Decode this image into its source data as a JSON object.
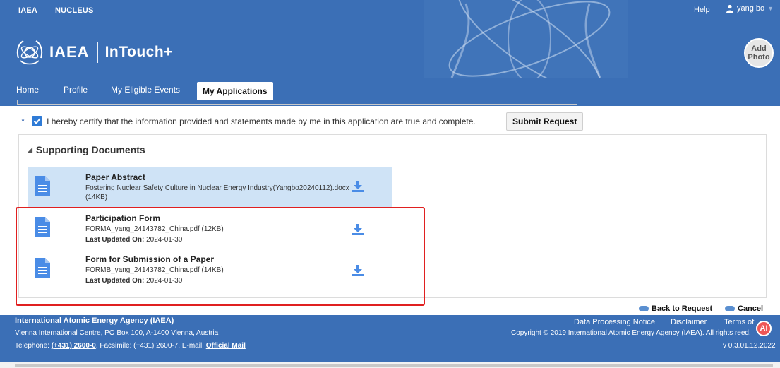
{
  "topnav": {
    "links": [
      "IAEA",
      "NUCLEUS"
    ],
    "help": "Help",
    "user": "yang bo"
  },
  "brand": {
    "org": "IAEA",
    "product": "InTouch+"
  },
  "avatar": {
    "line1": "Add",
    "line2": "Photo"
  },
  "tabs": [
    {
      "label": "Home",
      "active": false
    },
    {
      "label": "Profile",
      "active": false
    },
    {
      "label": "My Eligible Events",
      "active": false
    },
    {
      "label": "My Applications",
      "active": true
    }
  ],
  "certify": {
    "required_mark": "*",
    "checked": true,
    "text": "I hereby certify that the information provided and statements made by me in this application are true and complete."
  },
  "submit_label": "Submit Request",
  "supporting": {
    "heading": "Supporting Documents",
    "docs": [
      {
        "title": "Paper Abstract",
        "file": "Fostering Nuclear Safety Culture in Nuclear Energy Industry(Yangbo20240112).docx",
        "size": "(14KB)",
        "updated_label": "",
        "updated_value": ""
      },
      {
        "title": "Participation Form",
        "file": "FORMA_yang_24143782_China.pdf (12KB)",
        "updated_label": "Last Updated On:",
        "updated_value": "2024-01-30"
      },
      {
        "title": "Form for Submission of a Paper",
        "file": "FORMB_yang_24143782_China.pdf (14KB)",
        "updated_label": "Last Updated On:",
        "updated_value": "2024-01-30"
      }
    ]
  },
  "actions": {
    "back": "Back to Request",
    "cancel": "Cancel"
  },
  "footer": {
    "org": "International Atomic Energy Agency (IAEA)",
    "address": "Vienna International Centre, PO Box 100, A-1400 Vienna, Austria",
    "tel_prefix": "Telephone:",
    "tel": "(+431) 2600-0",
    "fax_text": ", Facsimile: (+431) 2600-7, E-mail:",
    "mail": "Official Mail",
    "links": [
      "Data Processing Notice",
      "Disclaimer",
      "Terms of"
    ],
    "copyright": "Copyright © 2019 International Atomic Energy Agency (IAEA). All rights re",
    "copyright_tail": "ed.",
    "version": "v 0.3.01.12.2022"
  },
  "ai_badge": "AI",
  "colors": {
    "brand_blue": "#3b6fb6",
    "selected_row": "#cfe3f6",
    "highlight_red": "#e02020",
    "icon_blue": "#4a8ce6"
  }
}
